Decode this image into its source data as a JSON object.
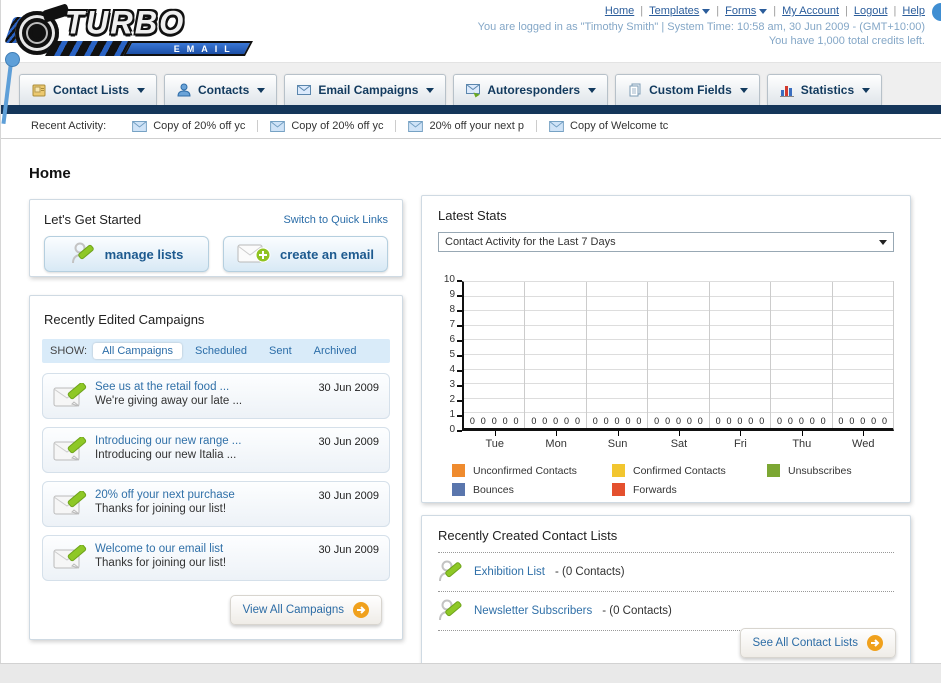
{
  "header": {
    "logo_title": "TURBO",
    "logo_subtitle": "EMAIL",
    "links": {
      "home": "Home",
      "templates": "Templates",
      "forms": "Forms",
      "my_account": "My Account",
      "logout": "Logout",
      "help": "Help"
    },
    "login_line": "You are logged in as \"Timothy Smith\" | System Time: 10:58 am, 30 Jun 2009 - (GMT+10:00)",
    "credits_line": "You have 1,000 total credits left."
  },
  "nav": {
    "tabs": [
      {
        "label": "Contact Lists"
      },
      {
        "label": "Contacts"
      },
      {
        "label": "Email Campaigns"
      },
      {
        "label": "Autoresponders"
      },
      {
        "label": "Custom Fields"
      },
      {
        "label": "Statistics"
      }
    ]
  },
  "recent_activity": {
    "label": "Recent Activity:",
    "items": [
      "Copy of 20% off yc",
      "Copy of 20% off yc",
      "20% off your next p",
      "Copy of Welcome tc"
    ]
  },
  "page_title": "Home",
  "get_started": {
    "title": "Let's Get Started",
    "switch_link": "Switch to Quick Links",
    "manage_lists_label": "manage lists",
    "create_email_label": "create an email"
  },
  "campaigns": {
    "title": "Recently Edited Campaigns",
    "show_label": "SHOW:",
    "filters": [
      "All Campaigns",
      "Scheduled",
      "Sent",
      "Archived"
    ],
    "active_filter": "All Campaigns",
    "items": [
      {
        "title": "See us at the retail food ...",
        "subtitle": "We're giving away our late ...",
        "date": "30 Jun 2009"
      },
      {
        "title": "Introducing our new range ...",
        "subtitle": "Introducing our new Italia ...",
        "date": "30 Jun 2009"
      },
      {
        "title": "20% off your next purchase",
        "subtitle": "Thanks for joining our list!",
        "date": "30 Jun 2009"
      },
      {
        "title": "Welcome to our email list",
        "subtitle": "Thanks for joining our list!",
        "date": "30 Jun 2009"
      }
    ],
    "view_all_label": "View All Campaigns"
  },
  "stats": {
    "title": "Latest Stats",
    "dropdown_value": "Contact Activity for the Last 7 Days"
  },
  "chart_data": {
    "type": "bar",
    "title": "Contact Activity for the Last 7 Days",
    "categories": [
      "Tue",
      "Mon",
      "Sun",
      "Sat",
      "Fri",
      "Thu",
      "Wed"
    ],
    "series": [
      {
        "name": "Unconfirmed Contacts",
        "color": "#ef8b2e",
        "values": [
          0,
          0,
          0,
          0,
          0,
          0,
          0
        ]
      },
      {
        "name": "Confirmed Contacts",
        "color": "#f2c62f",
        "values": [
          0,
          0,
          0,
          0,
          0,
          0,
          0
        ]
      },
      {
        "name": "Unsubscribes",
        "color": "#7ca733",
        "values": [
          0,
          0,
          0,
          0,
          0,
          0,
          0
        ]
      },
      {
        "name": "Bounces",
        "color": "#5a76ad",
        "values": [
          0,
          0,
          0,
          0,
          0,
          0,
          0
        ]
      },
      {
        "name": "Forwards",
        "color": "#e4502e",
        "values": [
          0,
          0,
          0,
          0,
          0,
          0,
          0
        ]
      }
    ],
    "ylim": [
      0,
      10
    ],
    "yticks": [
      0,
      1,
      2,
      3,
      4,
      5,
      6,
      7,
      8,
      9,
      10
    ],
    "grid": true,
    "legend_position": "bottom"
  },
  "contact_lists": {
    "title": "Recently Created Contact Lists",
    "items": [
      {
        "name": "Exhibition List",
        "detail": "- (0 Contacts)"
      },
      {
        "name": "Newsletter Subscribers",
        "detail": "- (0 Contacts)"
      }
    ],
    "see_all_label": "See All Contact Lists"
  }
}
